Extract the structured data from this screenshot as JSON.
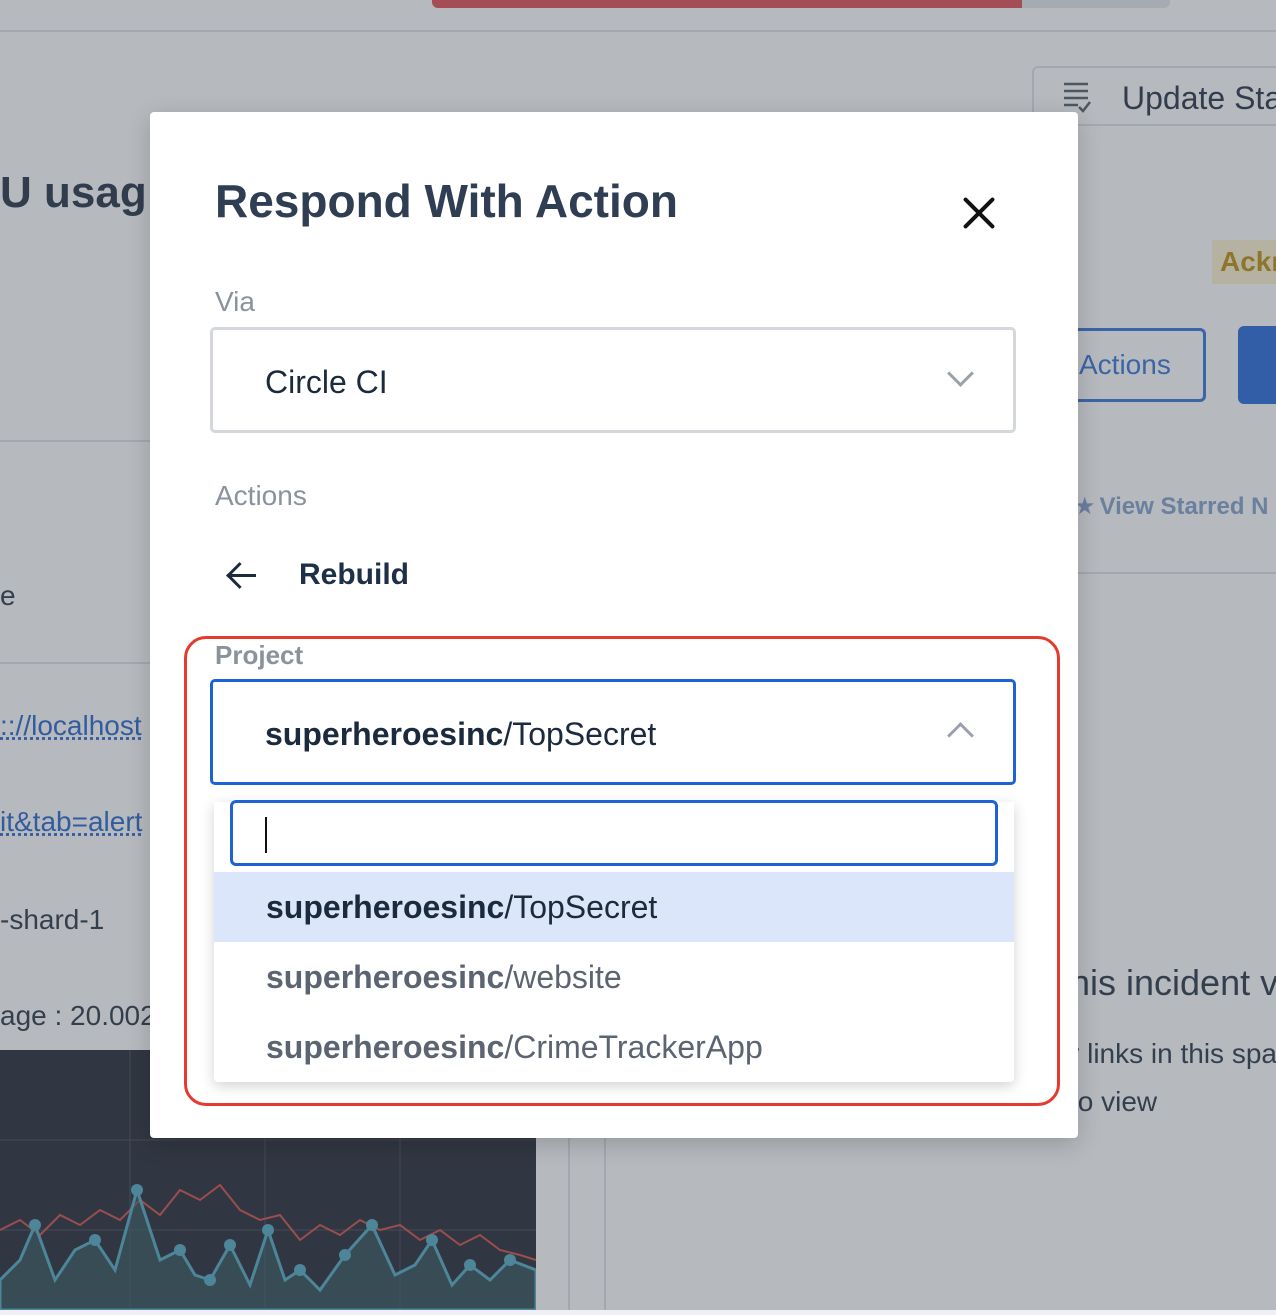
{
  "background": {
    "title_fragment": "U usag",
    "left_fragments": [
      "e",
      "-shard-1",
      "age : 20.002"
    ],
    "link_fragments": [
      ":://localhost",
      "it&tab=alert"
    ],
    "update_status_label": "Update Sta",
    "badge_fragment": "Ackn",
    "actions_button_label": "Actions",
    "view_starred_label": "View Starred N",
    "right_fragments": [
      "his incident v",
      "r links in this spa",
      "to view"
    ],
    "progress_fraction": 0.8
  },
  "modal": {
    "title": "Respond With Action",
    "via_label": "Via",
    "via_value": "Circle CI",
    "actions_label": "Actions",
    "action_name": "Rebuild",
    "project_label": "Project",
    "project_value_org": "superheroesinc",
    "project_value_repo": "/TopSecret",
    "search_value": "",
    "options": [
      {
        "org": "superheroesinc",
        "repo": "/TopSecret",
        "selected": true
      },
      {
        "org": "superheroesinc",
        "repo": "/website",
        "selected": false
      },
      {
        "org": "superheroesinc",
        "repo": "/CrimeTrackerApp",
        "selected": false
      }
    ]
  },
  "colors": {
    "primary": "#1e63d6",
    "highlight": "#e63a2e",
    "selected_option_bg": "#dbe6fb"
  }
}
